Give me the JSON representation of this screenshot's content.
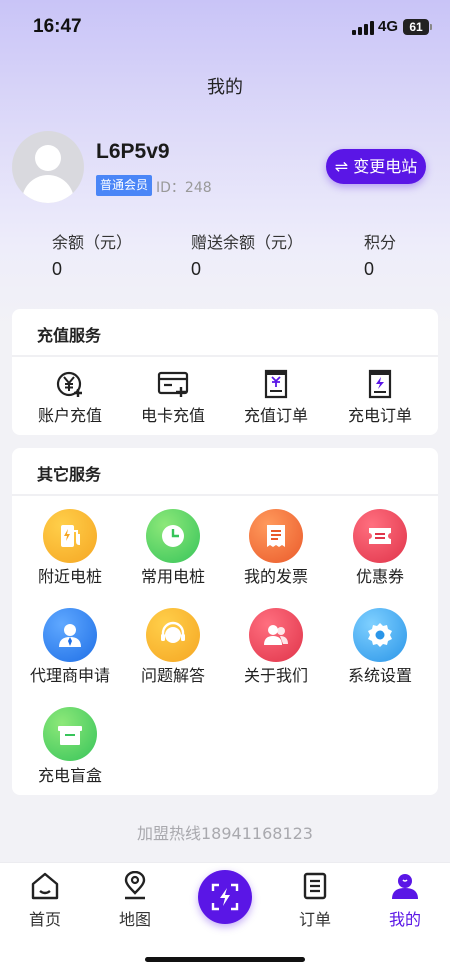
{
  "status_bar": {
    "time": "16:47",
    "network": "4G",
    "battery": "61"
  },
  "page": {
    "title": "我的"
  },
  "user": {
    "name": "L6P5v9",
    "member_level": "普通会员",
    "id_text": "ID：248"
  },
  "actions": {
    "change_station": "⇌ 变更电站"
  },
  "stats": [
    {
      "label": "余额（元）",
      "value": "0"
    },
    {
      "label": "赠送余额（元）",
      "value": "0"
    },
    {
      "label": "积分",
      "value": "0"
    }
  ],
  "recharge_services": {
    "title": "充值服务",
    "items": [
      {
        "label": "账户充值",
        "icon": "yuan-plus-icon"
      },
      {
        "label": "电卡充值",
        "icon": "card-plus-icon"
      },
      {
        "label": "充值订单",
        "icon": "yuan-doc-icon"
      },
      {
        "label": "充电订单",
        "icon": "bolt-doc-icon"
      }
    ]
  },
  "other_services": {
    "title": "其它服务",
    "items": [
      {
        "label": "附近电桩",
        "icon": "charging-pile-icon",
        "color": "#f5a623"
      },
      {
        "label": "常用电桩",
        "icon": "clock-icon",
        "color": "#4cd964"
      },
      {
        "label": "我的发票",
        "icon": "receipt-icon",
        "color": "#f26b3a"
      },
      {
        "label": "优惠券",
        "icon": "ticket-icon",
        "color": "#f0485c"
      },
      {
        "label": "代理商申请",
        "icon": "agent-icon",
        "color": "#2f86f6"
      },
      {
        "label": "问题解答",
        "icon": "headset-icon",
        "color": "#f5a623"
      },
      {
        "label": "关于我们",
        "icon": "people-icon",
        "color": "#f0485c"
      },
      {
        "label": "系统设置",
        "icon": "gear-icon",
        "color": "#3aa8f0"
      },
      {
        "label": "充电盲盒",
        "icon": "gift-box-icon",
        "color": "#4cd964"
      }
    ]
  },
  "footer": {
    "hotline": "加盟热线18941168123"
  },
  "tabbar": {
    "items": [
      {
        "label": "首页",
        "icon": "home-icon"
      },
      {
        "label": "地图",
        "icon": "map-pin-icon"
      },
      {
        "label": "",
        "icon": "scan-charge-icon"
      },
      {
        "label": "订单",
        "icon": "order-list-icon"
      },
      {
        "label": "我的",
        "icon": "profile-icon",
        "active": true
      }
    ],
    "accent": "#5a16e6"
  }
}
